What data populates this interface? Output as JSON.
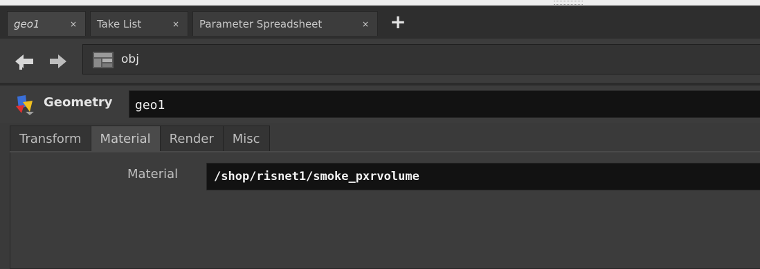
{
  "tabs": [
    {
      "label": "geo1",
      "active": true
    },
    {
      "label": "Take List",
      "active": false
    },
    {
      "label": "Parameter Spreadsheet",
      "active": false
    }
  ],
  "tab_close_glyph": "×",
  "new_tab_glyph": "+",
  "nav": {
    "back_icon": "arrow-left-icon",
    "forward_icon": "arrow-right-icon",
    "path_icon": "obj-network-icon",
    "path": "obj"
  },
  "node": {
    "type_icon": "geometry-icon",
    "type_label": "Geometry",
    "name": "geo1"
  },
  "param_tabs": [
    {
      "label": "Transform",
      "active": false
    },
    {
      "label": "Material",
      "active": true
    },
    {
      "label": "Render",
      "active": false
    },
    {
      "label": "Misc",
      "active": false
    }
  ],
  "parameters": {
    "material_label": "Material",
    "material_value": "/shop/risnet1/smoke_pxrvolume"
  },
  "colors": {
    "background": "#3a3a3a",
    "field_bg": "#121212",
    "text": "#cfcfcf"
  }
}
